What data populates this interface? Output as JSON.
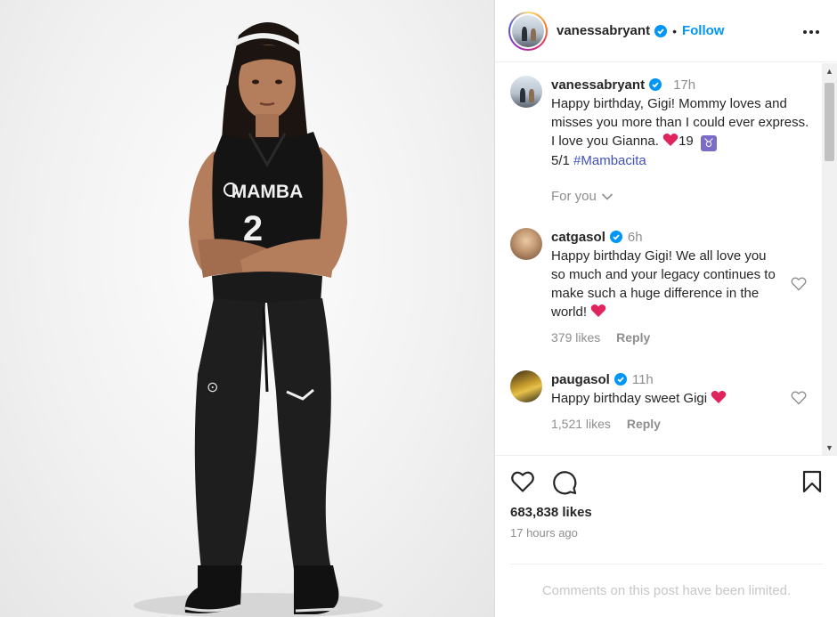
{
  "post": {
    "author": "vanessabryant",
    "follow_label": "Follow",
    "separator": "•",
    "more_label": "•••",
    "like_count": "683,838 likes",
    "posted_ago": "17 hours ago",
    "comments_limited": "Comments on this post have been limited."
  },
  "photo": {
    "jersey_text": "MAMBA",
    "jersey_number": "2"
  },
  "caption": {
    "username": "vanessabryant",
    "time": "17h",
    "text": "Happy birthday, Gigi! Mommy loves and misses you more than I could ever express. I love you Gianna. ",
    "after_heart": "19 ",
    "taurus_symbol": "♉",
    "line_end": "5/1 ",
    "hashtag": "#Mambacita"
  },
  "for_you": "For you",
  "comments": [
    {
      "username": "catgasol",
      "time": "6h",
      "text": "Happy birthday Gigi! We all love you so much and your legacy continues to make such a huge difference in the world! ",
      "likes": "379 likes",
      "reply": "Reply"
    },
    {
      "username": "paugasol",
      "time": "11h",
      "text": "Happy birthday sweet Gigi ",
      "likes": "1,521 likes",
      "reply": "Reply"
    }
  ],
  "scrollbar": {
    "up_glyph": "▲",
    "down_glyph": "▼"
  },
  "icons": {
    "verified": "verified-badge-icon",
    "more": "more-options-icon",
    "heart": "heart-icon",
    "comment": "comment-icon",
    "bookmark": "bookmark-icon",
    "chevron": "chevron-down-icon"
  },
  "colors": {
    "link_blue": "#0095f6",
    "hashtag": "#4051b5",
    "muted": "#8e8e8e",
    "heart_red": "#e0245e"
  }
}
